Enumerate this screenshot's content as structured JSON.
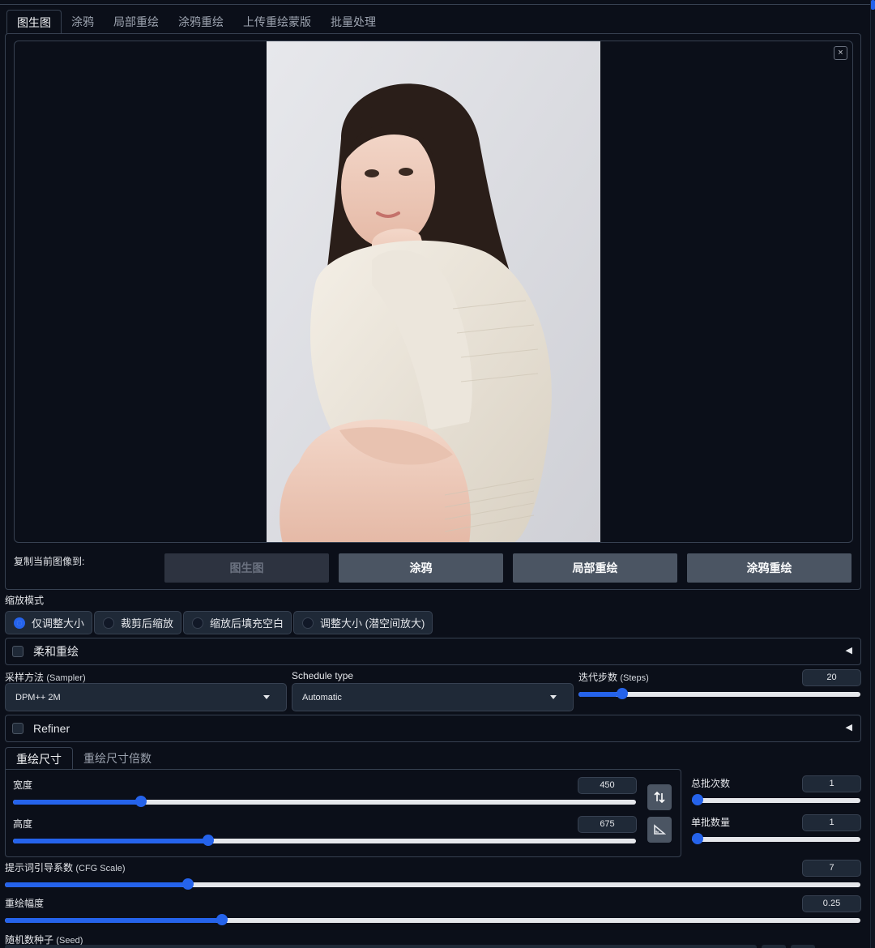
{
  "tabs": [
    {
      "label": "图生图",
      "active": true
    },
    {
      "label": "涂鸦"
    },
    {
      "label": "局部重绘"
    },
    {
      "label": "涂鸦重绘"
    },
    {
      "label": "上传重绘蒙版"
    },
    {
      "label": "批量处理"
    }
  ],
  "image_panel": {
    "close_label": "×",
    "image_description": "portrait photo"
  },
  "copy_to": {
    "label": "复制当前图像到:",
    "buttons": [
      "图生图",
      "涂鸦",
      "局部重绘",
      "涂鸦重绘"
    ],
    "disabled": [
      true,
      false,
      false,
      false
    ]
  },
  "resize_mode": {
    "label": "缩放模式",
    "options": [
      "仅调整大小",
      "裁剪后缩放",
      "缩放后填充空白",
      "调整大小 (潜空间放大)"
    ],
    "selected": "仅调整大小"
  },
  "soft_inpaint": {
    "label": "柔和重绘",
    "checked": false,
    "arrow": "◀"
  },
  "sampler": {
    "label": "采样方法",
    "label_en": "(Sampler)",
    "value": "DPM++ 2M"
  },
  "schedule": {
    "label": "Schedule type",
    "value": "Automatic"
  },
  "steps": {
    "label": "迭代步数",
    "label_en": "(Steps)",
    "value": "20",
    "fraction": 0.14
  },
  "refiner": {
    "label": "Refiner",
    "checked": false,
    "arrow": "◀"
  },
  "size_tabs": [
    {
      "label": "重绘尺寸",
      "active": true
    },
    {
      "label": "重绘尺寸倍数"
    }
  ],
  "width": {
    "label": "宽度",
    "value": "450",
    "fraction": 0.2
  },
  "height": {
    "label": "高度",
    "value": "675",
    "fraction": 0.31
  },
  "batch_count": {
    "label": "总批次数",
    "value": "1",
    "fraction": 0.0
  },
  "batch_size": {
    "label": "单批数量",
    "value": "1",
    "fraction": 0.0
  },
  "cfg": {
    "label": "提示词引导系数",
    "label_en": "(CFG Scale)",
    "value": "7",
    "fraction": 0.21
  },
  "denoise": {
    "label": "重绘幅度",
    "value": "0.25",
    "fraction": 0.25
  },
  "seed": {
    "label": "随机数种子",
    "label_en": "(Seed)"
  },
  "colors": {
    "accent": "#2563eb",
    "background": "#0b0f19",
    "panel": "#1f2937",
    "border": "#374151"
  },
  "icons": [
    "close-icon",
    "swap-icon",
    "aspect-ratio-icon",
    "chevron-left-icon",
    "caret-down-icon"
  ]
}
